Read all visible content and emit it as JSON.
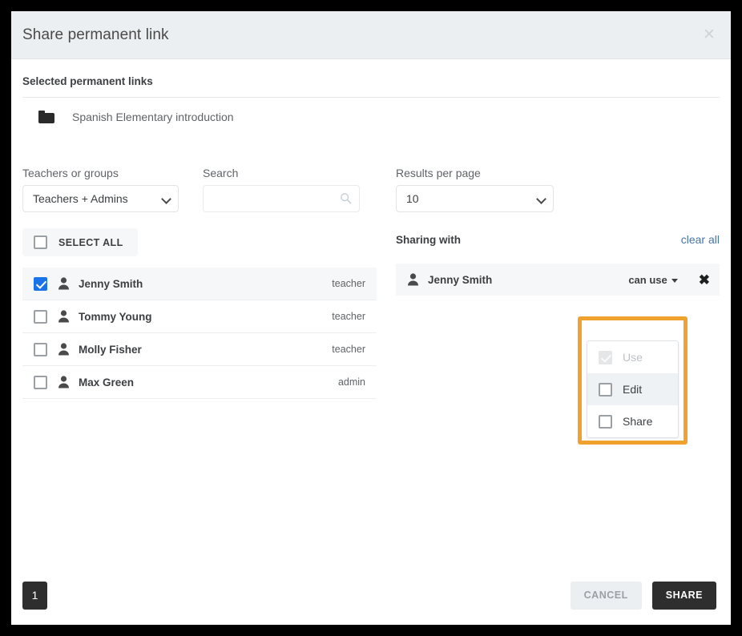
{
  "dialog": {
    "title": "Share permanent link",
    "close_icon": "close-icon"
  },
  "selected_section": {
    "heading": "Selected permanent links",
    "items": [
      {
        "icon": "folder-icon",
        "name": "Spanish Elementary introduction"
      }
    ]
  },
  "filters": {
    "group_label": "Teachers or groups",
    "group_value": "Teachers + Admins",
    "group_options": [
      "Teachers + Admins"
    ],
    "search_label": "Search",
    "search_value": "",
    "search_placeholder": "",
    "search_icon": "search-icon",
    "results_label": "Results per page",
    "results_value": "10",
    "results_options": [
      "10"
    ]
  },
  "select_all": {
    "label": "SELECT ALL",
    "checked": false
  },
  "users": [
    {
      "name": "Jenny Smith",
      "role": "teacher",
      "checked": true
    },
    {
      "name": "Tommy Young",
      "role": "teacher",
      "checked": false
    },
    {
      "name": "Molly Fisher",
      "role": "teacher",
      "checked": false
    },
    {
      "name": "Max Green",
      "role": "admin",
      "checked": false
    }
  ],
  "sharing": {
    "title": "Sharing with",
    "clear_all": "clear all",
    "entries": [
      {
        "name": "Jenny Smith",
        "permission_label": "can use",
        "remove_icon": "close-icon"
      }
    ],
    "permission_menu": {
      "open": true,
      "items": [
        {
          "label": "Use",
          "checked": true,
          "disabled": true
        },
        {
          "label": "Edit",
          "checked": false,
          "disabled": false
        },
        {
          "label": "Share",
          "checked": false,
          "disabled": false
        }
      ]
    },
    "highlight_color": "#f0a22e"
  },
  "footer": {
    "page": "1",
    "cancel_label": "CANCEL",
    "share_label": "SHARE"
  }
}
